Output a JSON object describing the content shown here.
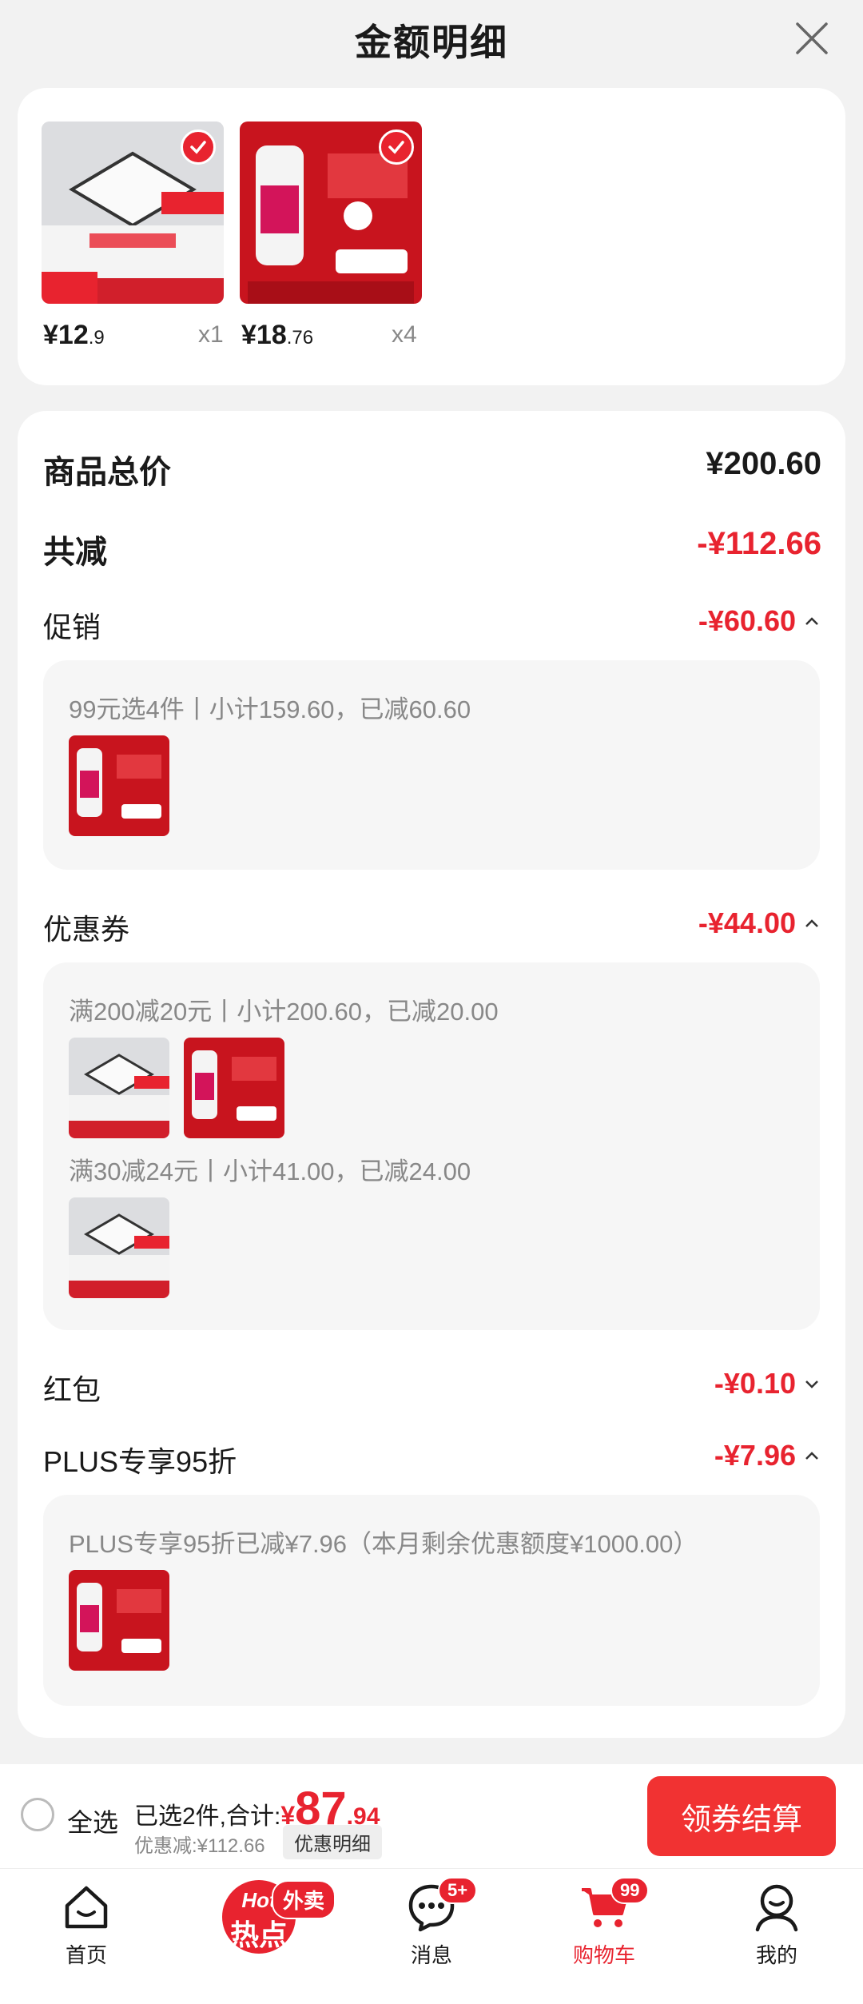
{
  "header": {
    "title": "金额明细"
  },
  "items": [
    {
      "price_int": "¥12",
      "price_dec": ".9",
      "qty": "x1"
    },
    {
      "price_int": "¥18",
      "price_dec": ".76",
      "qty": "x4"
    }
  ],
  "summary": {
    "total_label": "商品总价",
    "total_value": "¥200.60",
    "reduce_label": "共减",
    "reduce_value": "-¥112.66",
    "promo_label": "促销",
    "promo_value": "-¥60.60",
    "promo_detail": "99元选4件丨小计159.60，已减60.60",
    "coupon_label": "优惠券",
    "coupon_value": "-¥44.00",
    "coupon_detail_1": "满200减20元丨小计200.60，已减20.00",
    "coupon_detail_2": "满30减24元丨小计41.00，已减24.00",
    "redpack_label": "红包",
    "redpack_value": "-¥0.10",
    "plus_label": "PLUS专享95折",
    "plus_value": "-¥7.96",
    "plus_detail": "PLUS专享95折已减¥7.96（本月剩余优惠额度¥1000.00）"
  },
  "bottom": {
    "select_all": "全选",
    "selected_text": "已选2件,合计:",
    "currency": "¥",
    "total_int": "87",
    "total_dec": ".94",
    "discount_text": "优惠减:¥112.66",
    "detail_button": "优惠明细",
    "checkout_button": "领券结算"
  },
  "tabs": [
    {
      "label": "首页"
    },
    {
      "label": "热点",
      "badge": "外卖",
      "hot": "Hot"
    },
    {
      "label": "消息",
      "badge": "5+"
    },
    {
      "label": "购物车",
      "badge": "99"
    },
    {
      "label": "我的"
    }
  ],
  "colors": {
    "accent": "#e8232f",
    "background": "#f2f2f2",
    "card": "#ffffff"
  }
}
